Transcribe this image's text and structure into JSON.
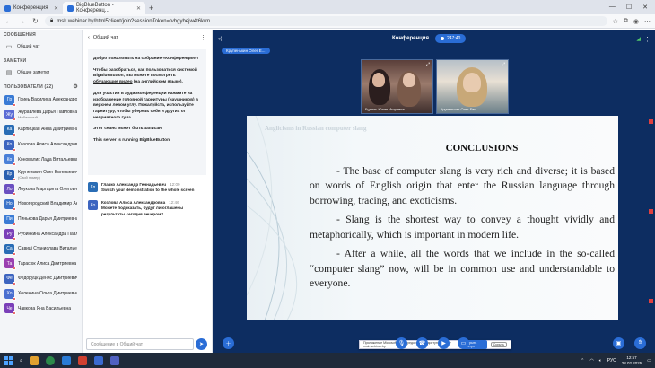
{
  "browser": {
    "tabs": [
      {
        "label": "Конференция",
        "active": false
      },
      {
        "label": "BigBlueButton - Конференц...",
        "active": true
      }
    ],
    "new_tab": "+",
    "url": "msk.webinar.by/html5client/join?sessionToken=tvbgybejw4t6krm"
  },
  "sidebar": {
    "messages_title": "СООБЩЕНИЯ",
    "public_chat": "Общий чат",
    "notes_title": "ЗАМЕТКИ",
    "shared_notes": "Общие заметки",
    "users_title": "ПОЛЬЗОВАТЕЛИ (22)",
    "users": [
      {
        "initials": "Гр",
        "name": "Гриеь Василиса Александровна",
        "color": "#3a7bd5",
        "sub": ""
      },
      {
        "initials": "Жу",
        "name": "Журавлева Дарья Павловна",
        "color": "#5b6bd5",
        "sub": "Мобильный"
      },
      {
        "initials": "Ка",
        "name": "Карпицкая Анна Дмитриевна",
        "color": "#2a6db5",
        "sub": ""
      },
      {
        "initials": "Ко",
        "name": "Козлова Алиса Александровна",
        "color": "#3d65c0",
        "sub": ""
      },
      {
        "initials": "Ко",
        "name": "Коновалик Лада Витальевна",
        "color": "#4a80d8",
        "sub": ""
      },
      {
        "initials": "Кр",
        "name": "Крупенькин Олег Евгеньевич",
        "color": "#2a5fb0",
        "sub": "(Свой номер)"
      },
      {
        "initials": "Ло",
        "name": "Лоукова Маргарита Олеговна",
        "color": "#6a4fc0",
        "sub": ""
      },
      {
        "initials": "Но",
        "name": "Новогородский Владимир Анато...",
        "color": "#3a72c9",
        "sub": ""
      },
      {
        "initials": "Пи",
        "name": "Пинькова Дарья Дмитриевна",
        "color": "#3a7bd5",
        "sub": ""
      },
      {
        "initials": "Ру",
        "name": "Рубинкина Александра Павловна",
        "color": "#7a3fb8",
        "sub": ""
      },
      {
        "initials": "Са",
        "name": "Савицi Станислава Витальевна",
        "color": "#2a6db5",
        "sub": ""
      },
      {
        "initials": "Та",
        "name": "Тарасюк Алиса Дмитриевна",
        "color": "#9a3fb0",
        "sub": ""
      },
      {
        "initials": "Фе",
        "name": "Федоруцк Денис Дмитриевич",
        "color": "#3d65c0",
        "sub": ""
      },
      {
        "initials": "Хо",
        "name": "Холенина Ольга Дмитриевна",
        "color": "#4a6fd0",
        "sub": ""
      },
      {
        "initials": "Че",
        "name": "Чавкова Яна Васильевна",
        "color": "#7a3fb8",
        "sub": ""
      }
    ]
  },
  "chat": {
    "title": "Общий чат",
    "welcome": {
      "p1": "Добро пожаловать на собрание «Конференция»!",
      "p2_a": "Чтобы разобраться, как пользоваться системой BigBlueButton, Вы можете посмотреть ",
      "p2_link": "обучающие видео",
      "p2_b": " (на английском языке).",
      "p3": "Для участия в аудиоконференции нажмите на изображение головной гарнитуры (наушников) в верхнем левом углу. Пожалуйста, используйте гарнитуру, чтобы уберечь себя и других от неприятного гула.",
      "p4": "Этот сеанс может быть записан.",
      "p5": "This server is running BigBlueButton."
    },
    "messages": [
      {
        "initials": "Гл",
        "color": "#2a6db5",
        "author": "Глазко Александр Геннадьевич",
        "time": "12:09",
        "text": "Switch your demonstration to the whole screen"
      },
      {
        "initials": "Ко",
        "color": "#3d65c0",
        "author": "Козлова Алиса Александровна",
        "time": "12:46",
        "text": "Можете подсказать, будут ли оглашены результаты сегодня вечером?"
      }
    ],
    "input_placeholder": "Сообщение в Общий чат",
    "send_icon": "send-icon"
  },
  "main": {
    "speaker": "Крупенькин Олег Е...",
    "title": "Конференция",
    "timer": "247:40",
    "cameras": [
      {
        "label": "Будаль Юлия Игоревна"
      },
      {
        "label": "Крупенькин Олег Евг..."
      }
    ],
    "slide": {
      "header": "Anglicisms in Russian computer slang",
      "title": "CONCLUSIONS",
      "paragraphs": [
        "- The base of computer slang is very rich and diverse; it is based on words of English origin that enter the Russian language through borrowing, tracing, and exoticisms.",
        "- Slang is the shortest way to convey a thought vividly and metaphorically, which is important in modern life.",
        "- After a while, all the words that we include in the so-called “computer slang” now, will be in common use and understandable to everyone."
      ]
    },
    "toast": {
      "text": "Приложение Microsoft Edge предоставило доступ к экрану msk.webinar.by",
      "stop": "Закрыть доступ",
      "hide": "Скрыть"
    }
  },
  "taskbar": {
    "lang": "РУС",
    "time": "12:57",
    "date": "28.02.2025"
  }
}
